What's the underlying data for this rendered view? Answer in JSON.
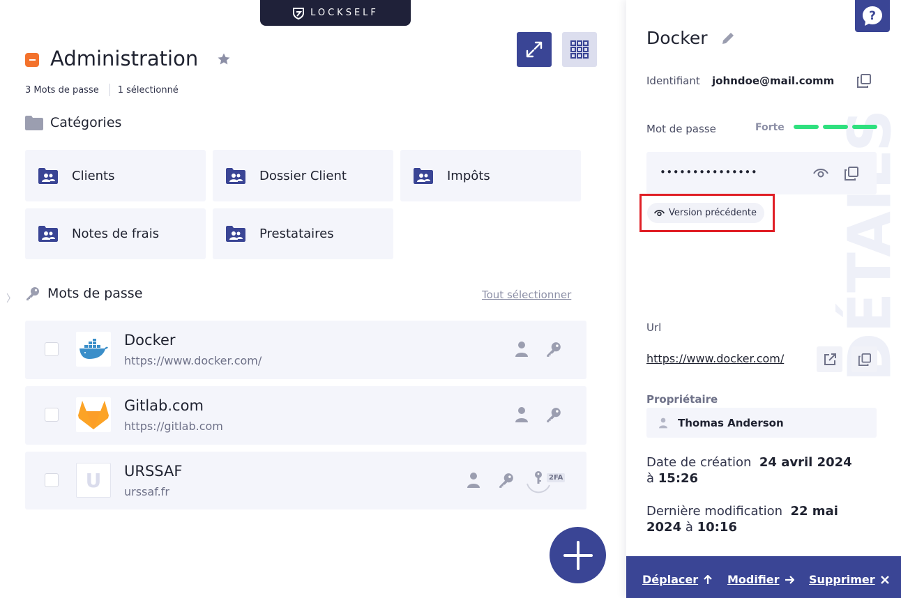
{
  "brand": {
    "name": "LOCKSELF"
  },
  "header": {
    "title": "Administration",
    "count_label": "3 Mots de passe",
    "selected_label": "1 sélectionné"
  },
  "categories": {
    "title": "Catégories",
    "items": [
      {
        "label": "Clients"
      },
      {
        "label": "Dossier Client"
      },
      {
        "label": "Impôts"
      },
      {
        "label": "Notes de frais"
      },
      {
        "label": "Prestataires"
      }
    ]
  },
  "passwords": {
    "title": "Mots de passe",
    "select_all": "Tout sélectionner",
    "items": [
      {
        "name": "Docker",
        "url": "https://www.docker.com/",
        "logo": "docker-whale"
      },
      {
        "name": "Gitlab.com",
        "url": "https://gitlab.com",
        "logo": "gitlab-fox"
      },
      {
        "name": "URSSAF",
        "url": "urssaf.fr",
        "logo_letter": "U",
        "badge": "2FA"
      }
    ]
  },
  "details": {
    "title": "Docker",
    "watermark": "DÉTAILS",
    "identifiant_label": "Identifiant",
    "identifiant_value": "johndoe@mail.comm",
    "password_label": "Mot de passe",
    "strength_label": "Forte",
    "strength_level": 3,
    "strength_max": 3,
    "password_masked": "•••••••••••••••",
    "previous_version": "Version précédente",
    "url_label": "Url",
    "url_value": "https://www.docker.com/",
    "owner_label": "Propriétaire",
    "owner_name": "Thomas Anderson",
    "created_label": "Date de création",
    "created_date": "24 avril 2024",
    "created_at_word": "à",
    "created_time": "15:26",
    "modified_label": "Dernière modification",
    "modified_date_1": "22 mai",
    "modified_date_2": "2024",
    "modified_at_word": "à",
    "modified_time": "10:16"
  },
  "actions": {
    "move": "Déplacer",
    "edit": "Modifier",
    "delete": "Supprimer"
  },
  "colors": {
    "primary": "#3a4595",
    "accent": "#f3722c",
    "strength": "#2ee07e",
    "highlight": "#e01f26"
  }
}
